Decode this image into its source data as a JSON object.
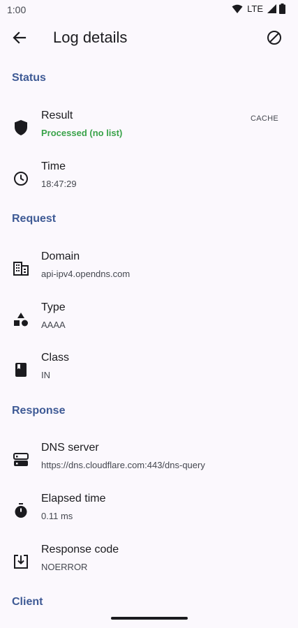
{
  "status_bar": {
    "time": "1:00",
    "network": "LTE"
  },
  "app_bar": {
    "title": "Log details"
  },
  "sections": {
    "status": "Status",
    "request": "Request",
    "response": "Response",
    "client": "Client"
  },
  "items": {
    "result": {
      "label": "Result",
      "value": "Processed (no list)",
      "trailing": "CACHE",
      "value_color": "#3aa34a"
    },
    "time": {
      "label": "Time",
      "value": "18:47:29"
    },
    "domain": {
      "label": "Domain",
      "value": "api-ipv4.opendns.com"
    },
    "type": {
      "label": "Type",
      "value": "AAAA"
    },
    "class": {
      "label": "Class",
      "value": "IN"
    },
    "dns_server": {
      "label": "DNS server",
      "value": "https://dns.cloudflare.com:443/dns-query"
    },
    "elapsed": {
      "label": "Elapsed time",
      "value": "0.11 ms"
    },
    "response_code": {
      "label": "Response code",
      "value": "NOERROR"
    }
  },
  "icons": {
    "result": "shield-icon",
    "time": "clock-icon",
    "domain": "domain-building-icon",
    "type": "shapes-icon",
    "class": "book-icon",
    "dns_server": "dns-server-icon",
    "elapsed": "timer-icon",
    "response_code": "download-box-icon"
  },
  "colors": {
    "accent": "#3e5a95",
    "background": "#fbf8fd",
    "success": "#3aa34a"
  }
}
